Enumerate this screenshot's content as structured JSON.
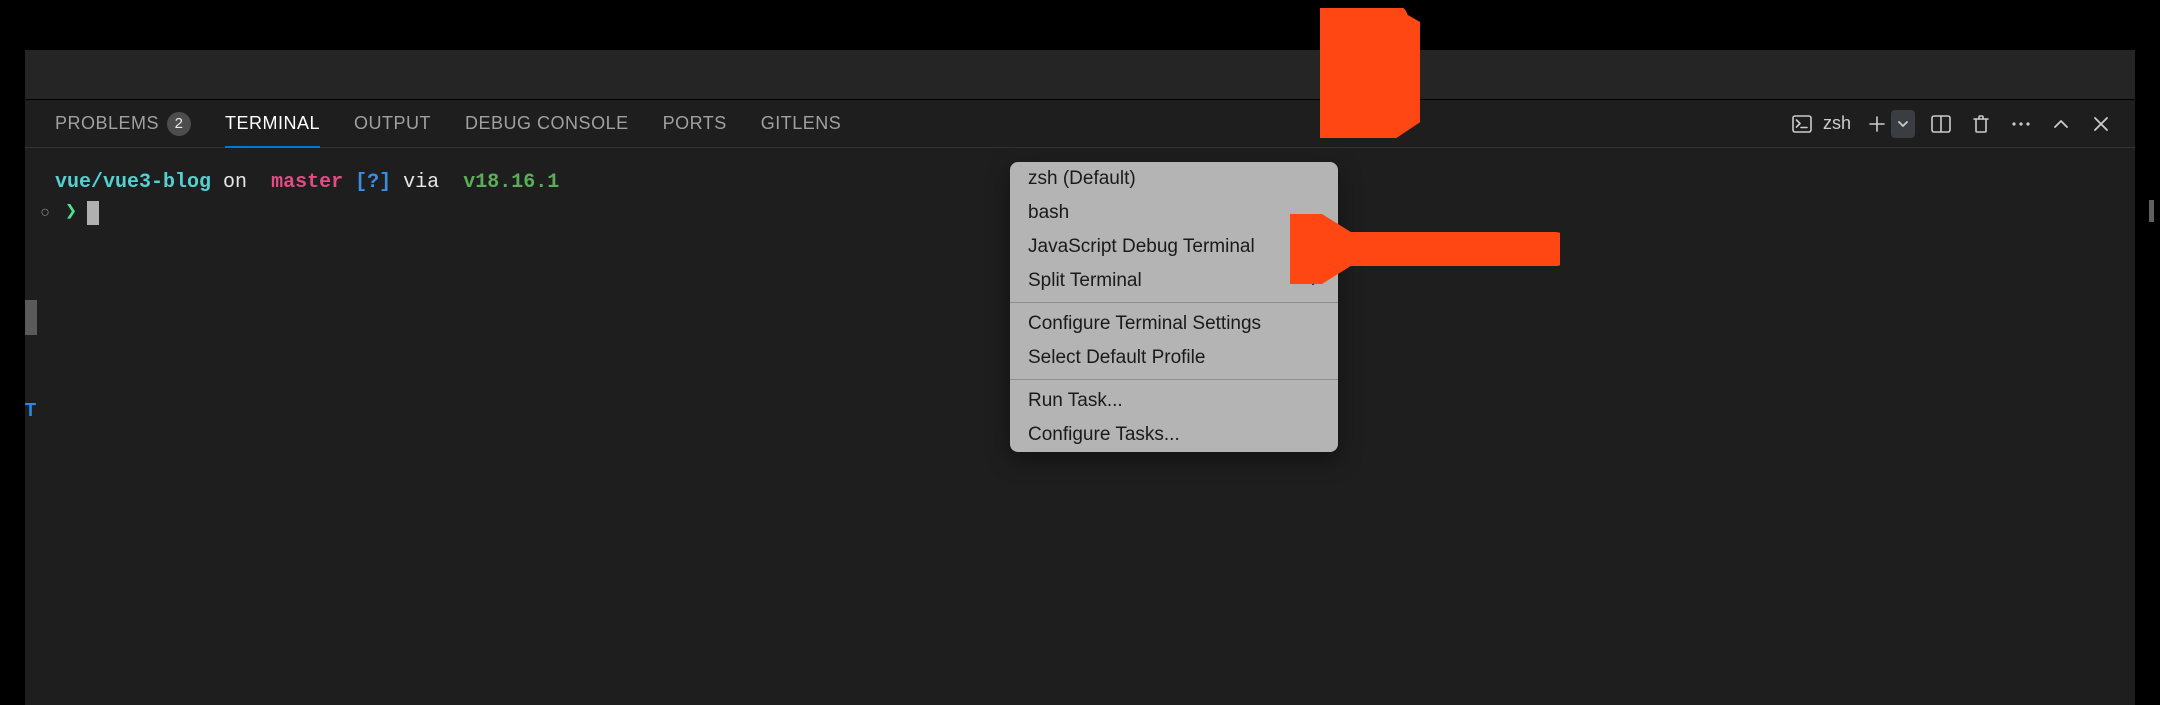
{
  "tabs": {
    "problems": "PROBLEMS",
    "problems_badge": "2",
    "terminal": "TERMINAL",
    "output": "OUTPUT",
    "debug_console": "DEBUG CONSOLE",
    "ports": "PORTS",
    "gitlens": "GITLENS"
  },
  "terminal_indicator": {
    "shell": "zsh"
  },
  "prompt": {
    "path": "vue/vue3-blog",
    "on_label": "on",
    "git_icon": "",
    "branch": "master",
    "status_flag": "[?]",
    "via_label": "via",
    "node_icon": "",
    "node_version": "v18.16.1",
    "angle": "❯"
  },
  "menu": {
    "items_group1": [
      "zsh (Default)",
      "bash",
      "JavaScript Debug Terminal"
    ],
    "split_terminal": "Split Terminal",
    "items_group2": [
      "Configure Terminal Settings",
      "Select Default Profile"
    ],
    "items_group3": [
      "Run Task...",
      "Configure Tasks..."
    ]
  },
  "left_hint": "T",
  "colors": {
    "annotation_arrow": "#ff4713"
  }
}
